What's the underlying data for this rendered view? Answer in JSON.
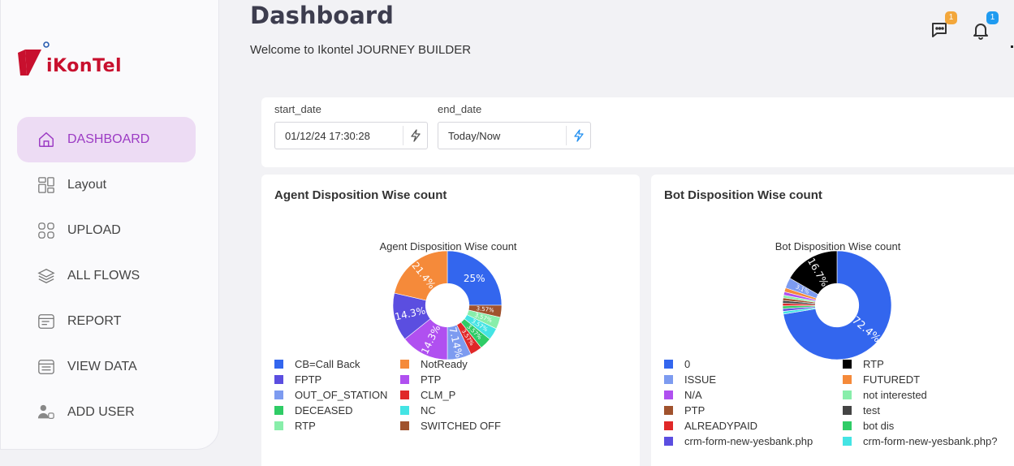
{
  "app": {
    "brand": "iKonTel",
    "title": "Dashboard",
    "welcome": "Welcome to Ikontel JOURNEY BUILDER"
  },
  "header": {
    "chat_badge": "1",
    "notification_badge": "1"
  },
  "sidebar": {
    "items": [
      {
        "label": "DASHBOARD",
        "icon": "home-icon",
        "active": true
      },
      {
        "label": "Layout",
        "icon": "layout-icon"
      },
      {
        "label": "UPLOAD",
        "icon": "grid-icon"
      },
      {
        "label": "ALL FLOWS",
        "icon": "layers-icon"
      },
      {
        "label": "REPORT",
        "icon": "report-icon"
      },
      {
        "label": "VIEW DATA",
        "icon": "table-icon"
      },
      {
        "label": "ADD USER",
        "icon": "add-user-icon"
      }
    ]
  },
  "filters": {
    "start_label": "start_date",
    "start_value": "01/12/24 17:30:28",
    "end_label": "end_date",
    "end_value": "Today/Now"
  },
  "colors": {
    "brand_red": "#c8102e",
    "accent_purple": "#9c3bc4",
    "active_bg": "#eddcf4"
  },
  "chart_data": [
    {
      "type": "pie",
      "card_title": "Agent Disposition Wise count",
      "title": "Agent Disposition Wise count",
      "hole": 0.4,
      "legend_position": "bottom",
      "slices": [
        {
          "label": "CB=Call Back",
          "value": 25,
          "text": "25%",
          "color": "#3366ee"
        },
        {
          "label": "SWITCHED OFF",
          "value": 3.57,
          "text": "3.57%",
          "color": "#a0522d"
        },
        {
          "label": "RTP",
          "value": 3.57,
          "text": "3.57%",
          "color": "#88eeaa"
        },
        {
          "label": "NC",
          "value": 3.57,
          "text": "3.57%",
          "color": "#44e4e4"
        },
        {
          "label": "DECEASED",
          "value": 3.57,
          "text": "3.57%",
          "color": "#2fcc66"
        },
        {
          "label": "CLM_P",
          "value": 3.57,
          "text": "3.57%",
          "color": "#e02828"
        },
        {
          "label": "OUT_OF_STATION",
          "value": 7.14,
          "text": "7.14%",
          "color": "#7d9bf0"
        },
        {
          "label": "PTP",
          "value": 14.3,
          "text": "14.3%",
          "color": "#b050f0"
        },
        {
          "label": "FPTP",
          "value": 14.3,
          "text": "14.3%",
          "color": "#5b4ee0"
        },
        {
          "label": "NotReady",
          "value": 21.4,
          "text": "21.4%",
          "color": "#f58a3a"
        }
      ],
      "legend": [
        {
          "label": "CB=Call Back",
          "color": "#3366ee"
        },
        {
          "label": "NotReady",
          "color": "#f58a3a"
        },
        {
          "label": "FPTP",
          "color": "#5b4ee0"
        },
        {
          "label": "PTP",
          "color": "#b050f0"
        },
        {
          "label": "OUT_OF_STATION",
          "color": "#7d9bf0"
        },
        {
          "label": "CLM_P",
          "color": "#e02828"
        },
        {
          "label": "DECEASED",
          "color": "#2fcc66"
        },
        {
          "label": "NC",
          "color": "#44e4e4"
        },
        {
          "label": "RTP",
          "color": "#88eeaa"
        },
        {
          "label": "SWITCHED OFF",
          "color": "#a0522d"
        }
      ]
    },
    {
      "type": "pie",
      "card_title": "Bot Disposition Wise count",
      "title": "Bot Disposition Wise count",
      "hole": 0.4,
      "legend_position": "bottom",
      "slices": [
        {
          "label": "0",
          "value": 72.4,
          "text": "72.4%",
          "color": "#3366ee"
        },
        {
          "label": "crm-form-new-yesbank.php?",
          "value": 0.8,
          "text": "",
          "color": "#44e4e4"
        },
        {
          "label": "crm-form-new-yesbank.php",
          "value": 0.8,
          "text": "",
          "color": "#5b4ee0"
        },
        {
          "label": "bot dis",
          "value": 0.8,
          "text": "",
          "color": "#2fcc66"
        },
        {
          "label": "ALREADYPAID",
          "value": 0.8,
          "text": "",
          "color": "#e02828"
        },
        {
          "label": "test",
          "value": 0.8,
          "text": "",
          "color": "#444444"
        },
        {
          "label": "PTP",
          "value": 0.8,
          "text": "",
          "color": "#a0522d"
        },
        {
          "label": "not interested",
          "value": 0.8,
          "text": "",
          "color": "#88eeaa"
        },
        {
          "label": "N/A",
          "value": 1.0,
          "text": "",
          "color": "#b050f0"
        },
        {
          "label": "FUTUREDT",
          "value": 1.2,
          "text": "",
          "color": "#f58a3a"
        },
        {
          "label": "ISSUE",
          "value": 3.1,
          "text": "3.1%",
          "color": "#7d9bf0"
        },
        {
          "label": "RTP",
          "value": 16.7,
          "text": "16.7%",
          "color": "#000000"
        }
      ],
      "legend": [
        {
          "label": "0",
          "color": "#3366ee"
        },
        {
          "label": "RTP",
          "color": "#000000"
        },
        {
          "label": "ISSUE",
          "color": "#7d9bf0"
        },
        {
          "label": "FUTUREDT",
          "color": "#f58a3a"
        },
        {
          "label": "N/A",
          "color": "#b050f0"
        },
        {
          "label": "not interested",
          "color": "#88eeaa"
        },
        {
          "label": "PTP",
          "color": "#a0522d"
        },
        {
          "label": "test",
          "color": "#444444"
        },
        {
          "label": "ALREADYPAID",
          "color": "#e02828"
        },
        {
          "label": "bot dis",
          "color": "#2fcc66"
        },
        {
          "label": "crm-form-new-yesbank.php",
          "color": "#5b4ee0"
        },
        {
          "label": "crm-form-new-yesbank.php?",
          "color": "#44e4e4"
        }
      ]
    }
  ]
}
